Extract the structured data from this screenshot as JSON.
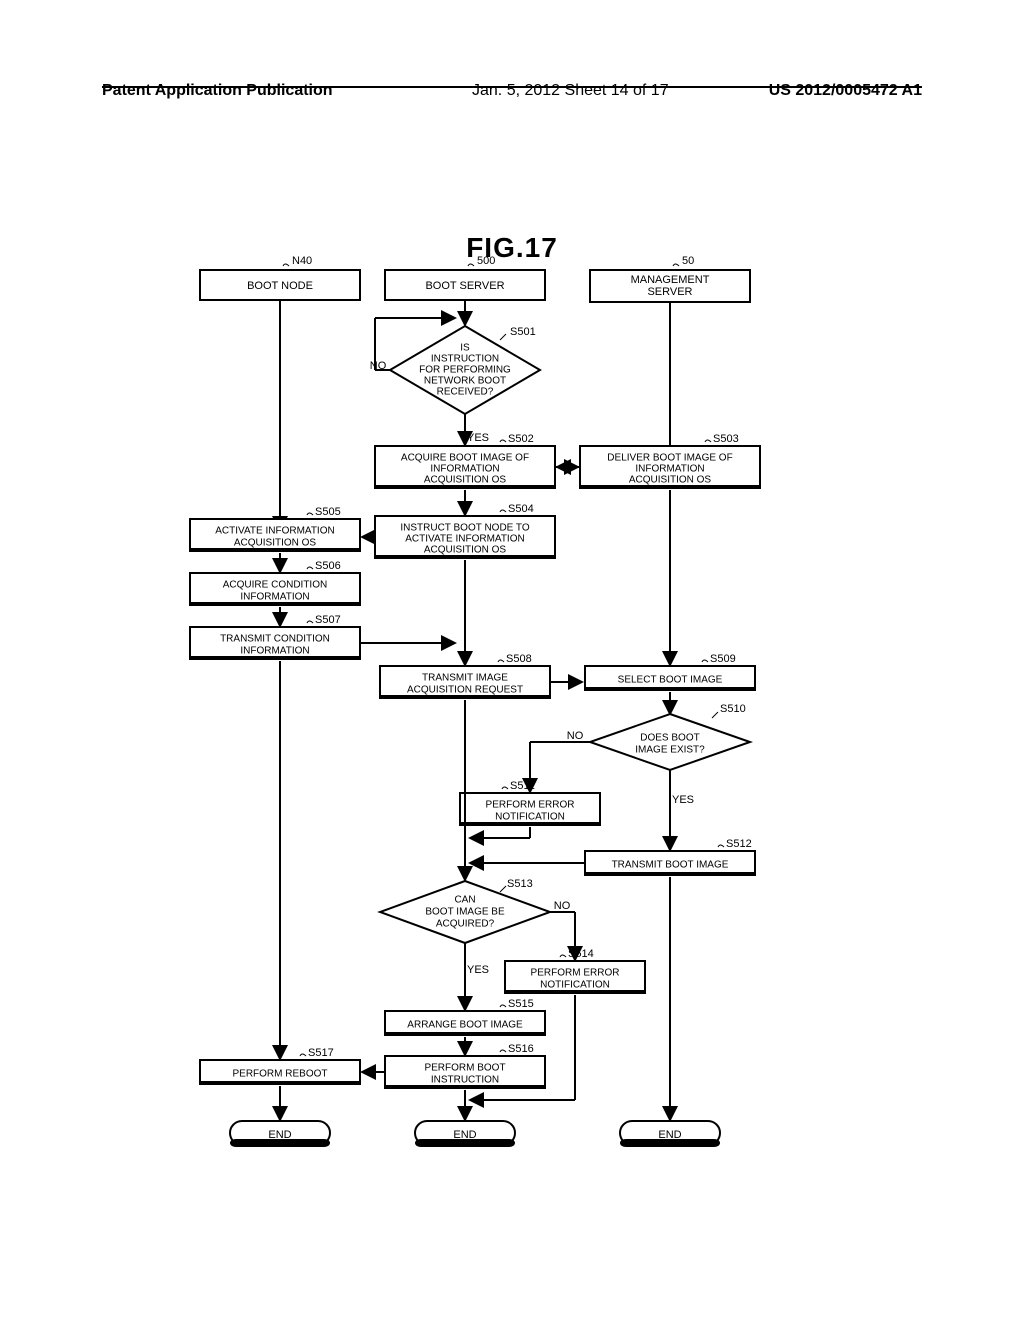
{
  "header": {
    "left": "Patent Application Publication",
    "mid": "Jan. 5, 2012   Sheet 14 of 17",
    "right": "US 2012/0005472 A1"
  },
  "figure_title": "FIG.17",
  "lanes": {
    "boot_node": {
      "ref": "N40",
      "label": "BOOT NODE"
    },
    "boot_server": {
      "ref": "500",
      "label": "BOOT SERVER"
    },
    "mgmt_server": {
      "ref": "50",
      "label": "MANAGEMENT\nSERVER"
    }
  },
  "steps": {
    "s501": {
      "ref": "S501",
      "text": "IS\nINSTRUCTION\nFOR PERFORMING\nNETWORK BOOT\nRECEIVED?"
    },
    "s502": {
      "ref": "S502",
      "text": "ACQUIRE BOOT IMAGE OF\nINFORMATION\nACQUISITION OS"
    },
    "s503": {
      "ref": "S503",
      "text": "DELIVER BOOT IMAGE OF\nINFORMATION\nACQUISITION OS"
    },
    "s504": {
      "ref": "S504",
      "text": "INSTRUCT BOOT NODE TO\nACTIVATE INFORMATION\nACQUISITION OS"
    },
    "s505": {
      "ref": "S505",
      "text": "ACTIVATE INFORMATION\nACQUISITION OS"
    },
    "s506": {
      "ref": "S506",
      "text": "ACQUIRE CONDITION\nINFORMATION"
    },
    "s507": {
      "ref": "S507",
      "text": "TRANSMIT CONDITION\nINFORMATION"
    },
    "s508": {
      "ref": "S508",
      "text": "TRANSMIT IMAGE\nACQUISITION REQUEST"
    },
    "s509": {
      "ref": "S509",
      "text": "SELECT BOOT IMAGE"
    },
    "s510": {
      "ref": "S510",
      "text": "DOES BOOT\nIMAGE EXIST?"
    },
    "s511": {
      "ref": "S511",
      "text": "PERFORM ERROR\nNOTIFICATION"
    },
    "s512": {
      "ref": "S512",
      "text": "TRANSMIT BOOT IMAGE"
    },
    "s513": {
      "ref": "S513",
      "text": "CAN\nBOOT IMAGE BE\nACQUIRED?"
    },
    "s514": {
      "ref": "S514",
      "text": "PERFORM ERROR\nNOTIFICATION"
    },
    "s515": {
      "ref": "S515",
      "text": "ARRANGE BOOT IMAGE"
    },
    "s516": {
      "ref": "S516",
      "text": "PERFORM BOOT\nINSTRUCTION"
    },
    "s517": {
      "ref": "S517",
      "text": "PERFORM REBOOT"
    }
  },
  "labels": {
    "yes": "YES",
    "no": "NO",
    "end": "END"
  }
}
